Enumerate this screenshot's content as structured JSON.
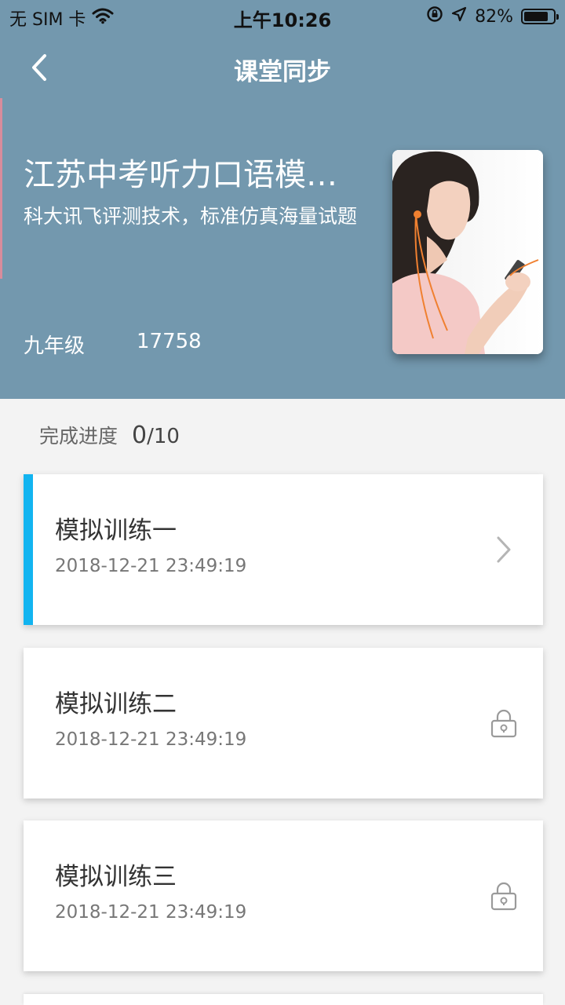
{
  "status_bar": {
    "carrier": "无 SIM 卡",
    "time": "上午10:26",
    "battery_text": "82%",
    "battery_level": 0.82,
    "icons": [
      "wifi-icon",
      "rotation-lock-icon",
      "location-arrow-icon",
      "battery-icon"
    ]
  },
  "nav": {
    "title": "课堂同步",
    "back_icon": "chevron-left-icon"
  },
  "book": {
    "title": "江苏中考听力口语模…",
    "description": "科大讯飞评测技术，标准仿真海量试题",
    "grade": "九年级",
    "count": "17758",
    "cover_image": "girl-with-earphones-photo"
  },
  "progress": {
    "label": "完成进度",
    "done": "0",
    "total": "/10"
  },
  "lessons": [
    {
      "title": "模拟训练一",
      "date": "2018-12-21 23:49:19",
      "state": "open",
      "icon": "chevron-right-icon"
    },
    {
      "title": "模拟训练二",
      "date": "2018-12-21 23:49:19",
      "state": "locked",
      "icon": "lock-icon"
    },
    {
      "title": "模拟训练三",
      "date": "2018-12-21 23:49:19",
      "state": "locked",
      "icon": "lock-icon"
    }
  ],
  "colors": {
    "header_bg": "#7398ae",
    "accent": "#12b4f0",
    "page_bg": "#f3f3f3"
  }
}
